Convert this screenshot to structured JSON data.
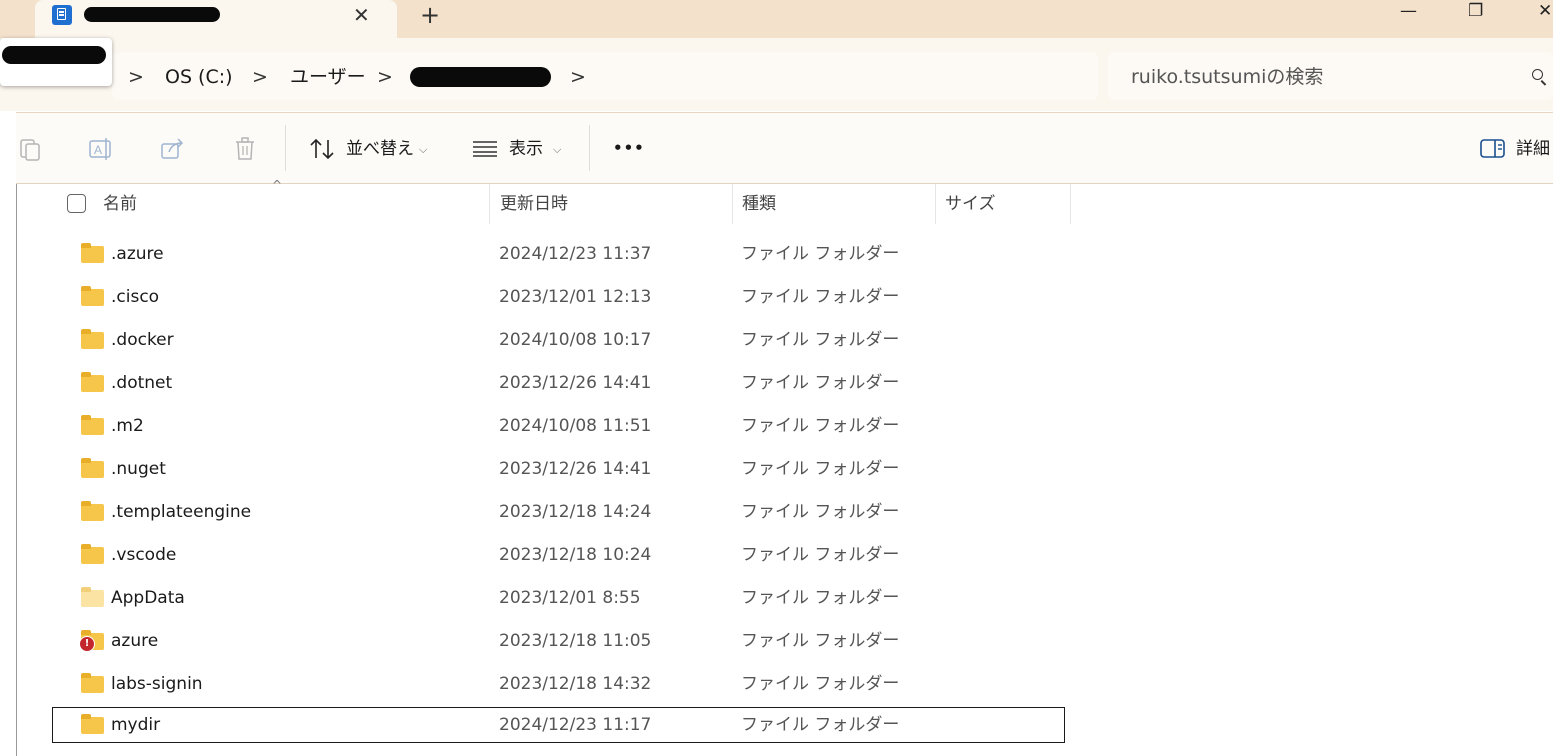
{
  "window": {
    "new_tab_symbol": "+",
    "close_tab_symbol": "✕",
    "minimize_symbol": "—",
    "restore_symbol": "❐",
    "close_symbol": "✕"
  },
  "breadcrumb": {
    "items": [
      "OS (C:)",
      "ユーザー"
    ],
    "separator": ">"
  },
  "search": {
    "placeholder": "ruiko.tsutsumiの検索"
  },
  "toolbar": {
    "sort_label": "並べ替え",
    "view_label": "表示",
    "more_label": "•••",
    "details_label": "詳細",
    "chevron": "⌵"
  },
  "columns": {
    "name": "名前",
    "modified": "更新日時",
    "type": "種類",
    "size": "サイズ"
  },
  "files": [
    {
      "name": ".azure",
      "modified": "2024/12/23 11:37",
      "type": "ファイル フォルダー"
    },
    {
      "name": ".cisco",
      "modified": "2023/12/01 12:13",
      "type": "ファイル フォルダー"
    },
    {
      "name": ".docker",
      "modified": "2024/10/08 10:17",
      "type": "ファイル フォルダー"
    },
    {
      "name": ".dotnet",
      "modified": "2023/12/26 14:41",
      "type": "ファイル フォルダー"
    },
    {
      "name": ".m2",
      "modified": "2024/10/08 11:51",
      "type": "ファイル フォルダー"
    },
    {
      "name": ".nuget",
      "modified": "2023/12/26 14:41",
      "type": "ファイル フォルダー"
    },
    {
      "name": ".templateengine",
      "modified": "2023/12/18 14:24",
      "type": "ファイル フォルダー"
    },
    {
      "name": ".vscode",
      "modified": "2023/12/18 10:24",
      "type": "ファイル フォルダー"
    },
    {
      "name": "AppData",
      "modified": "2023/12/01 8:55",
      "type": "ファイル フォルダー",
      "hidden": true
    },
    {
      "name": "azure",
      "modified": "2023/12/18 11:05",
      "type": "ファイル フォルダー",
      "error_badge": "!"
    },
    {
      "name": "labs-signin",
      "modified": "2023/12/18 14:32",
      "type": "ファイル フォルダー"
    },
    {
      "name": "mydir",
      "modified": "2024/12/23 11:17",
      "type": "ファイル フォルダー",
      "selected": true
    }
  ],
  "colors": {
    "titlebar": "#f3e1cb",
    "folder": "#f6c64a",
    "tab_icon": "#1f6fd0",
    "error": "#c4262e"
  },
  "icons": [
    "app-icon",
    "close-icon",
    "plus-icon",
    "minimize-icon",
    "restore-icon",
    "chevron-right-icon",
    "search-icon",
    "copy-icon",
    "rename-icon",
    "share-icon",
    "delete-icon",
    "sort-icon",
    "view-icon",
    "more-icon",
    "details-pane-icon",
    "folder-icon",
    "error-badge-icon"
  ]
}
